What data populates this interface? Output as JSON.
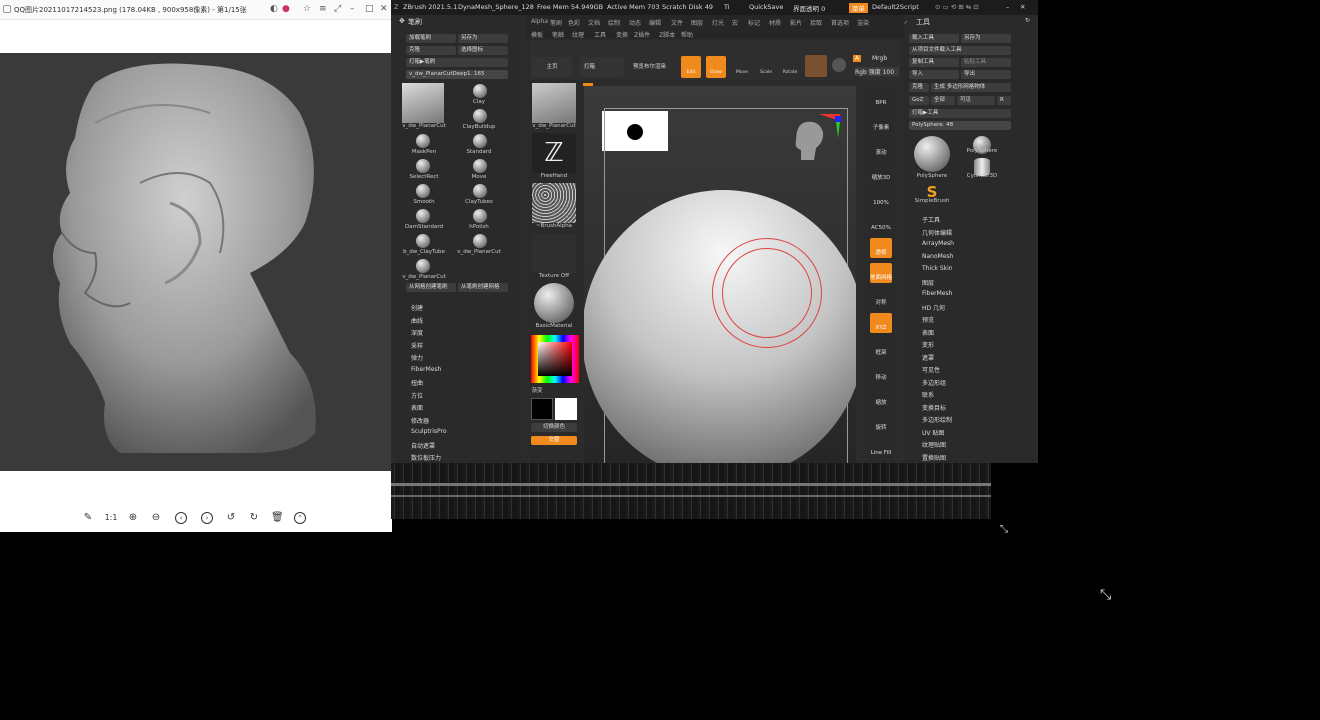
{
  "viewer": {
    "title": "QQ图片20211017214523.png (178.04KB , 900x958像素) - 第1/15张",
    "toolbar_labels": [
      "1:1"
    ]
  },
  "zbrush": {
    "title": "ZBrush 2021.5.1",
    "doc": "DynaMesh_Sphere_128",
    "free_mem": "Free Mem 54.949GB",
    "active_mem": "Active Mem 703",
    "scratch": "Scratch Disk 49",
    "ti": "Ti",
    "quicksave": "QuickSave",
    "transparency": "界面透明 0",
    "menu_btn": "菜单",
    "script": "Default2Script",
    "menus_row1": [
      "Alpha",
      "笔刷",
      "色彩",
      "文档",
      "绘制",
      "动态",
      "编辑",
      "文件",
      "图层",
      "灯光",
      "宏",
      "标记",
      "材质",
      "影片",
      "拾取",
      "首选项",
      "渲染"
    ],
    "menus_row2": [
      "模板",
      "笔触",
      "纹理",
      "工具",
      "变换",
      "Z插件",
      "Z脚本",
      "帮助"
    ],
    "brush_palette": {
      "title": "笔刷",
      "load": "加载笔刷",
      "save_as": "另存为",
      "clone": "克隆",
      "select_icon": "选择图标",
      "lightbox": "灯箱▶笔刷",
      "current": "v_dw_PlanarCutDeep1. 165",
      "brushes": [
        "v_dw_PlanarCut",
        "Clay",
        "ClayBuildup",
        "MaskPen",
        "Standard",
        "SelectRect",
        "Move",
        "Smooth",
        "ClayTubes",
        "DamStandard",
        "hPolish",
        "b_dw_ClayTube",
        "v_dw_PlanarCut",
        "v_dw_PlanarCut"
      ],
      "create_from_mesh": "从网格创建笔刷",
      "create_mesh_from_brush": "从笔刷创建网格",
      "subpalettes": [
        "创建",
        "曲线",
        "深度",
        "采样",
        "弹力",
        "FiberMesh",
        "扭曲",
        "方位",
        "表面",
        "修改器",
        "SculptrisPro",
        "自动遮罩",
        "数位板压力"
      ]
    },
    "shelf": {
      "brush": "v_dw_PlanarCut",
      "stroke": "FreeHand",
      "alpha": "~BrushAlpha",
      "texture": "Texture Off",
      "material": "BasicMaterial",
      "gradient": "渐变",
      "switch_color": "切换颜色",
      "alternate": "交替"
    },
    "top_bar": {
      "home": "主页",
      "lightbox": "灯箱",
      "preview": "预览布尔渲染",
      "edit": "Edit",
      "draw": "Draw",
      "move": "Move",
      "scale": "Scale",
      "rotate": "Rotate",
      "a": "A",
      "mrgb": "Mrgb",
      "rgb": "Rgb 强度 100"
    },
    "right_strip": [
      "BPR",
      "子像素",
      "滚动",
      "缩放3D",
      "100%",
      "AC50%",
      "透视",
      "地面网格",
      "对称",
      "XYZ",
      "框架",
      "移动",
      "缩放",
      "旋转",
      "Line Fill"
    ],
    "tool_palette": {
      "title": "工具",
      "load": "载入工具",
      "save_as": "另存为",
      "load_from_project": "从项目文件载入工具",
      "copy": "复制工具",
      "paste": "粘贴工具",
      "import": "导入",
      "export": "导出",
      "clone": "克隆",
      "make_poly": "生成 多边形网格物体",
      "goz": "GoZ",
      "all": "全部",
      "visible": "可见",
      "r": "R",
      "lightbox": "灯箱▶工具",
      "current": "PolySphere. 48",
      "tools": [
        "PolySphere",
        "PolySphere",
        "Cylinder3D",
        "SimpleBrush"
      ],
      "subpalettes": [
        "子工具",
        "几何体编辑",
        "ArrayMesh",
        "NanoMesh",
        "Thick Skin",
        "图层",
        "FiberMesh",
        "HD 几何",
        "预览",
        "表面",
        "变形",
        "遮罩",
        "可见性",
        "多边形组",
        "联系",
        "变换目标",
        "多边形绘制",
        "UV 贴图",
        "纹理贴图",
        "置换贴图"
      ]
    }
  }
}
